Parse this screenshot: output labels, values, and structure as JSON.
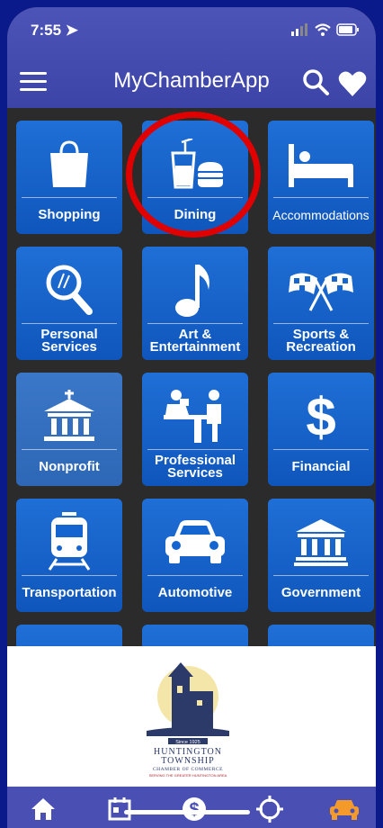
{
  "status": {
    "time": "7:55"
  },
  "header": {
    "title": "MyChamberApp"
  },
  "tiles": [
    {
      "label": "Shopping",
      "icon": "shopping-bag-icon"
    },
    {
      "label": "Dining",
      "icon": "dining-icon"
    },
    {
      "label": "Accommodations",
      "icon": "bed-icon"
    },
    {
      "label": "Personal\nServices",
      "icon": "magnifier-icon"
    },
    {
      "label": "Art &\nEntertainment",
      "icon": "music-note-icon"
    },
    {
      "label": "Sports &\nRecreation",
      "icon": "checkered-flags-icon"
    },
    {
      "label": "Nonprofit",
      "icon": "building-icon"
    },
    {
      "label": "Professional\nServices",
      "icon": "professional-icon"
    },
    {
      "label": "Financial",
      "icon": "dollar-icon"
    },
    {
      "label": "Transportation",
      "icon": "train-icon"
    },
    {
      "label": "Automotive",
      "icon": "car-icon"
    },
    {
      "label": "Government",
      "icon": "government-icon"
    }
  ],
  "banner": {
    "org_line1": "HUNTINGTON",
    "org_line2": "TOWNSHIP",
    "org_line3": "CHAMBER OF COMMERCE",
    "tagline": "SERVING THE GREATER HUNTINGTON AREA",
    "since": "Since 1925"
  },
  "tabbar": {
    "items": [
      "home-icon",
      "calendar-icon",
      "dollar-circle-icon",
      "target-icon",
      "car-icon"
    ],
    "active_color": "#f39a2b"
  },
  "colors": {
    "tile": "#1565d0",
    "header": "#4a4fb4",
    "highlight": "#e00000"
  }
}
